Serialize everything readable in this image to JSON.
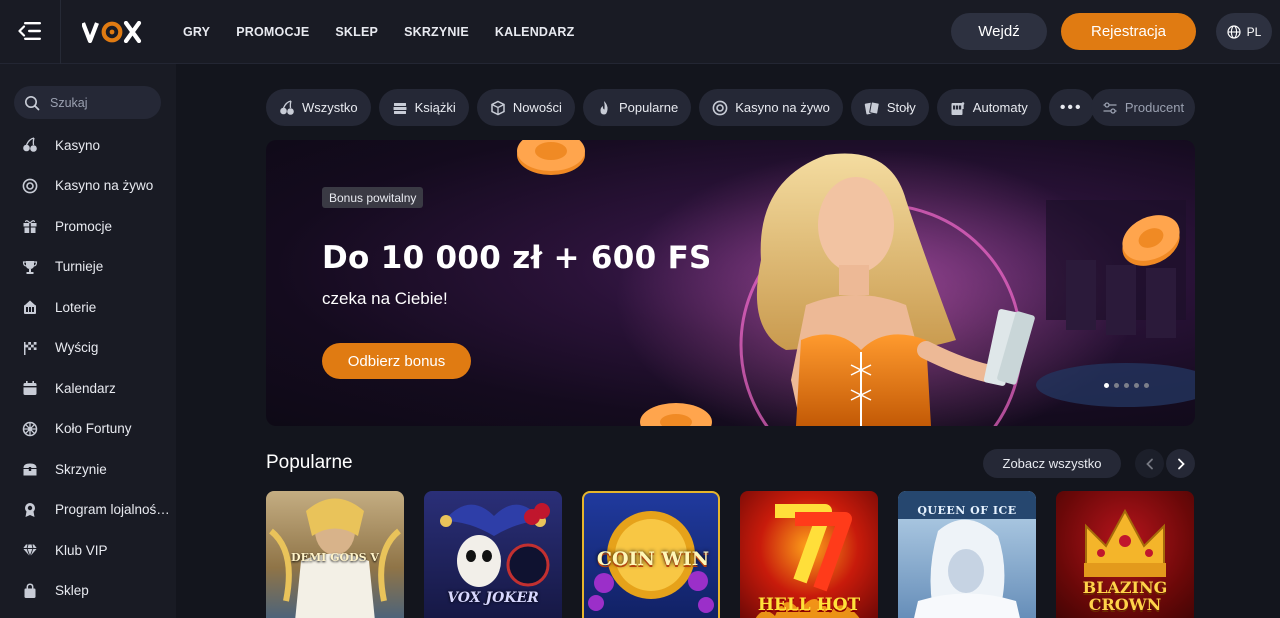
{
  "header": {
    "logo": "VOX",
    "nav": [
      "GRY",
      "PROMOCJE",
      "SKLEP",
      "SKRZYNIE",
      "KALENDARZ"
    ],
    "login_label": "Wejdź",
    "register_label": "Rejestracja",
    "language": "PL"
  },
  "sidebar": {
    "search_placeholder": "Szukaj",
    "items": [
      {
        "label": "Kasyno",
        "icon": "cherries-icon"
      },
      {
        "label": "Kasyno na żywo",
        "icon": "roulette-icon"
      },
      {
        "label": "Promocje",
        "icon": "gift-icon"
      },
      {
        "label": "Turnieje",
        "icon": "trophy-icon"
      },
      {
        "label": "Loterie",
        "icon": "lottery-icon"
      },
      {
        "label": "Wyścig",
        "icon": "race-flag-icon"
      },
      {
        "label": "Kalendarz",
        "icon": "calendar-icon"
      },
      {
        "label": "Koło Fortuny",
        "icon": "wheel-icon"
      },
      {
        "label": "Skrzynie",
        "icon": "chest-icon"
      },
      {
        "label": "Program lojalności...",
        "icon": "loyalty-badge-icon"
      },
      {
        "label": "Klub VIP",
        "icon": "diamond-icon"
      },
      {
        "label": "Sklep",
        "icon": "shopping-bag-icon"
      }
    ]
  },
  "categories": {
    "items": [
      {
        "label": "Wszystko",
        "icon": "cherries-icon"
      },
      {
        "label": "Książki",
        "icon": "books-icon"
      },
      {
        "label": "Nowości",
        "icon": "cube-icon"
      },
      {
        "label": "Popularne",
        "icon": "flame-icon"
      },
      {
        "label": "Kasyno na żywo",
        "icon": "roulette-icon"
      },
      {
        "label": "Stoły",
        "icon": "cards-icon"
      },
      {
        "label": "Automaty",
        "icon": "slot-machine-icon"
      }
    ],
    "more_label": "•••",
    "producer_label": "Producent"
  },
  "banner": {
    "badge": "Bonus powitalny",
    "title": "Do 10 000 zł + 600 FS",
    "subtitle": "czeka na Ciebie!",
    "cta": "Odbierz bonus"
  },
  "popular": {
    "title": "Popularne",
    "see_all": "Zobacz wszystko",
    "games": [
      {
        "name": "DEMI GODS V",
        "bg": "#a38a5e"
      },
      {
        "name": "VOX JOKER",
        "bg": "#1b1e4a"
      },
      {
        "name": "COIN WIN",
        "bg": "#1a2a7a"
      },
      {
        "name": "HELL HOT",
        "bg": "#8a0e0e"
      },
      {
        "name": "QUEEN OF ICE",
        "bg": "#7fa6c9"
      },
      {
        "name": "BLAZING CROWN",
        "bg": "#6a0a0a"
      }
    ]
  },
  "colors": {
    "accent": "#e07b12",
    "background": "#13151d",
    "panel": "#191b24",
    "pill": "#252836"
  }
}
